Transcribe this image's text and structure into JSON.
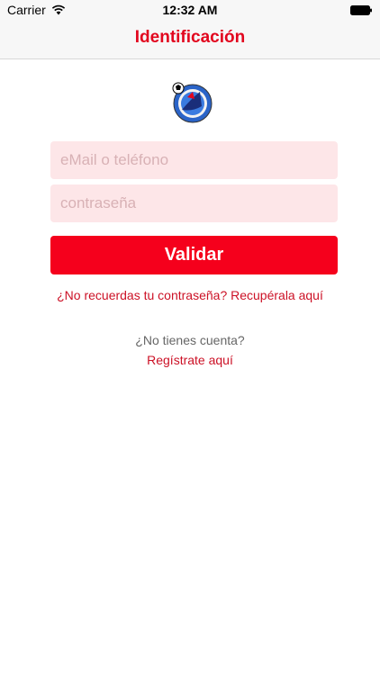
{
  "status_bar": {
    "carrier": "Carrier",
    "time": "12:32 AM",
    "wifi_icon": "wifi-icon",
    "battery_icon": "battery-icon"
  },
  "nav": {
    "title": "Identificación"
  },
  "logo": {
    "icon": "club-logo"
  },
  "form": {
    "email_placeholder": "eMail o teléfono",
    "password_placeholder": "contraseña",
    "email_value": "",
    "password_value": "",
    "submit_label": "Validar"
  },
  "links": {
    "forgot_password": "¿No recuerdas tu contraseña? Recupérala aquí",
    "no_account": "¿No tienes cuenta?",
    "register": "Regístrate aquí"
  },
  "colors": {
    "accent": "#e2061e",
    "button": "#f5001c",
    "field_bg": "#fde6e8",
    "link": "#cc1126"
  }
}
